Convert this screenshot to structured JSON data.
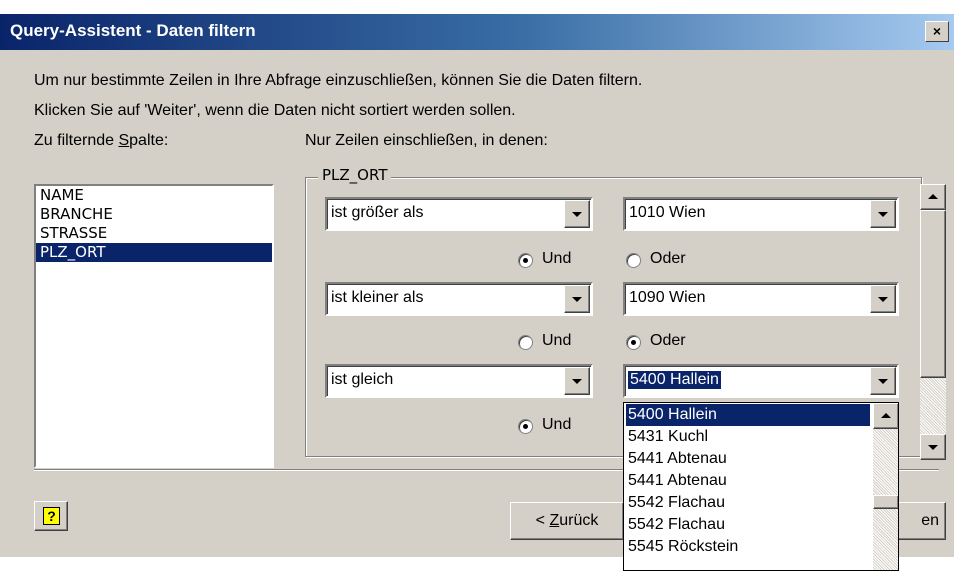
{
  "window": {
    "title": "Query-Assistent - Daten filtern",
    "close_symbol": "×"
  },
  "instructions": {
    "line1": "Um nur bestimmte Zeilen in Ihre Abfrage einzuschließen, können Sie die Daten filtern.",
    "line2": "Klicken Sie auf 'Weiter', wenn die Daten nicht sortiert werden sollen."
  },
  "columns_label": {
    "before": "Zu filternde ",
    "mnemonic": "S",
    "after": "palte:"
  },
  "columns": {
    "items": [
      "NAME",
      "BRANCHE",
      "STRASSE",
      "PLZ_ORT"
    ],
    "selected": "PLZ_ORT"
  },
  "filter_label": "Nur Zeilen einschließen, in denen:",
  "group_title": "PLZ_ORT",
  "conditions": [
    {
      "operator": "ist größer als",
      "value": "1010  Wien",
      "und": "Und",
      "oder": "Oder",
      "selected": "und"
    },
    {
      "operator": "ist kleiner als",
      "value": "1090 Wien",
      "und": "Und",
      "oder": "Oder",
      "selected": "oder"
    },
    {
      "operator": "ist gleich",
      "value": "5400 Hallein",
      "und": "Und",
      "selected": "und"
    }
  ],
  "dropdown": {
    "options": [
      "5400 Hallein",
      "5431 Kuchl",
      "5441  Abtenau",
      "5441 Abtenau",
      "5542  Flachau",
      "5542 Flachau",
      "5545  Röckstein"
    ],
    "selected": "5400 Hallein"
  },
  "buttons": {
    "help_icon": "?",
    "back_prefix": "< ",
    "back_mnemonic": "Z",
    "back_rest": "urück",
    "next_visible": "en"
  },
  "colors": {
    "title_bar": "#0a246a",
    "dialog_bg": "#d4d0c8",
    "selection": "#0a246a"
  }
}
